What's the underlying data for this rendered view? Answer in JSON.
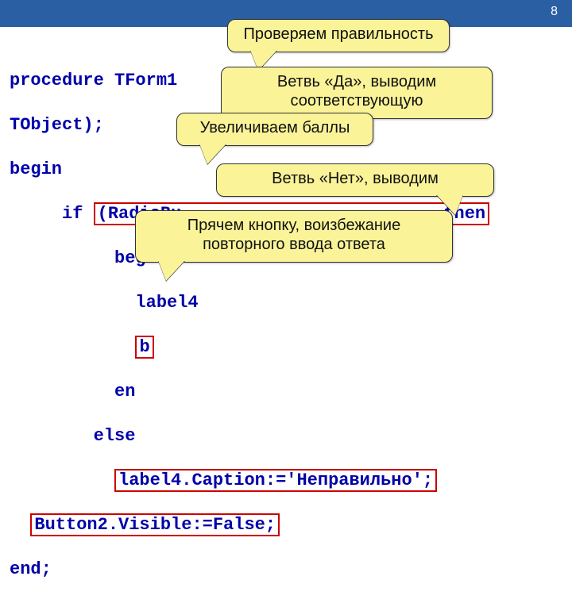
{
  "page_number": "8",
  "code": {
    "l1": "procedure TForm1",
    "l2": "TObject);",
    "l3": "begin",
    "l4a": "     if ",
    "l4b": "(RadioBu                         then",
    "l5": "          begin",
    "l6": "            label4",
    "l7a": "            ",
    "l7b": "b",
    "l8": "          en",
    "l9": "        else",
    "l10a": "          ",
    "l10b": "label4.Caption:='Неправильно';",
    "l11a": "  ",
    "l11b": "Button2.Visible:=False;",
    "l12": "end;"
  },
  "callouts": {
    "c1": "Проверяем правильность",
    "c2": "Ветвь «Да», выводим соответствующую",
    "c3": "Увеличиваем баллы",
    "c4": "Ветвь «Нет», выводим",
    "c5": "Прячем кнопку, воизбежание повторного ввода ответа"
  }
}
